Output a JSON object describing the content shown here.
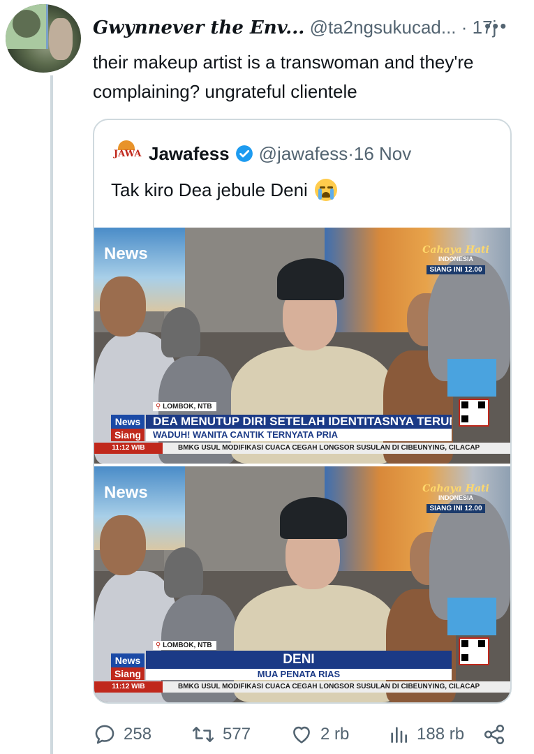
{
  "tweet": {
    "author_name": "Gwynnever the Env...",
    "author_handle": "@ta2ngsukucad...",
    "separator": " · ",
    "time": "17j",
    "text": "their makeup artist is a transwoman and they're complaining? ungrateful clientele"
  },
  "quote": {
    "logo_text": "JAWA",
    "name": "Jawafess",
    "handle": "@jawafess",
    "separator": " · ",
    "date": "16 Nov",
    "text": "Tak kiro Dea jebule Deni",
    "emoji": "loudly-crying-face"
  },
  "screenshot_1": {
    "poster_label": "News",
    "logo_brand": "Cahaya Hati",
    "logo_sub": "INDONESIA",
    "logo_siang": "SIANG INI",
    "logo_time": "12.00",
    "location": "LOMBOK, NTB",
    "news_label": "News",
    "siang_label": "Siang",
    "time": "11:12 WIB",
    "headline": "DEA MENUTUP DIRI SETELAH IDENTITASNYA TERUNGKAP",
    "subheadline": "WADUH! WANITA CANTIK TERNYATA PRIA",
    "ticker": "BMKG USUL MODIFIKASI CUACA CEGAH LONGSOR SUSULAN DI CIBEUNYING, CILACAP"
  },
  "screenshot_2": {
    "poster_label": "News",
    "logo_brand": "Cahaya Hati",
    "logo_sub": "INDONESIA",
    "logo_siang": "SIANG INI",
    "logo_time": "12.00",
    "location": "LOMBOK, NTB",
    "news_label": "News",
    "siang_label": "Siang",
    "time": "11:12 WIB",
    "name": "DENI",
    "role": "MUA PENATA RIAS",
    "ticker": "BMKG USUL MODIFIKASI CUACA CEGAH LONGSOR SUSULAN DI CIBEUNYING, CILACAP"
  },
  "actions": {
    "replies": "258",
    "reposts": "577",
    "likes": "2 rb",
    "views": "188 rb"
  },
  "colors": {
    "text": "#0f1419",
    "muted": "#536471",
    "verified": "#1d9bf0",
    "border": "#cfd9de"
  }
}
